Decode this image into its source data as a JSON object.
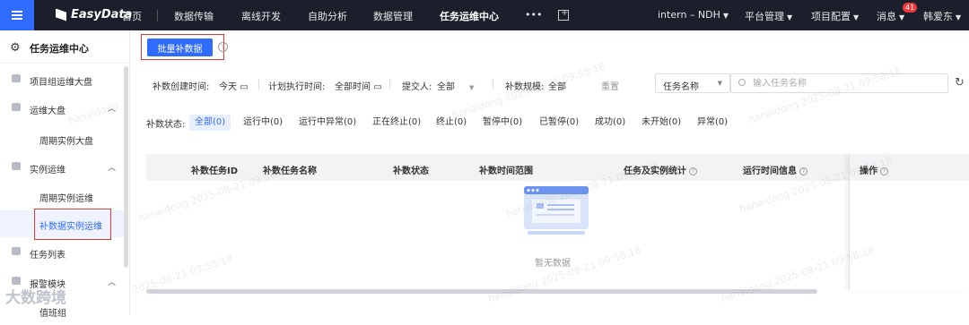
{
  "topbar": {
    "brand": "EasyData",
    "nav": [
      "首页",
      "数据传输",
      "离线开发",
      "自助分析",
      "数据管理",
      "任务运维中心"
    ],
    "more": "•••",
    "project": "intern – NDH",
    "menus": [
      "平台管理",
      "项目配置"
    ],
    "messages_label": "消息",
    "messages_count": "41",
    "user": "韩爱东"
  },
  "sidebar": {
    "title": "任务运维中心",
    "items": {
      "project_dashboard": "项目组运维大盘",
      "ops_dashboard": "运维大盘",
      "period_dashboard": "周期实例大盘",
      "instance_ops": "实例运维",
      "period_ops": "周期实例运维",
      "backfill_ops": "补数据实例运维",
      "task_list": "任务列表",
      "alert_module": "报警模块",
      "on_duty": "值班组"
    },
    "watermark_logo": "大数跨境"
  },
  "toolbar": {
    "batch_backfill": "批量补数据"
  },
  "filters": {
    "created_label": "补数创建时间:",
    "created_value": "今天",
    "planned_label": "计划执行时间:",
    "planned_value": "全部时间",
    "submitter_label": "提交人:",
    "submitter_value": "全部",
    "scale_label": "补数规模:",
    "scale_value": "全部",
    "reset": "重置",
    "search_type": "任务名称",
    "search_placeholder": "输入任务名称"
  },
  "status": {
    "label": "补数状态:",
    "chips": [
      "全部(0)",
      "运行中(0)",
      "运行中异常(0)",
      "正在终止(0)",
      "终止(0)",
      "暂停中(0)",
      "已暂停(0)",
      "成功(0)",
      "未开始(0)",
      "异常(0)"
    ]
  },
  "table": {
    "columns": [
      "补数任务ID",
      "补数任务名称",
      "补数状态",
      "补数时间范围",
      "任务及实例统计",
      "运行时间信息",
      "操作"
    ],
    "empty_text": "暂无数据"
  },
  "watermark": {
    "user": "hanaidong",
    "timestamp": "2025-08-21 09:58:18"
  },
  "colors": {
    "primary": "#2f6bff",
    "topbar": "#1b1e2b",
    "highlight_box": "#e33333"
  }
}
